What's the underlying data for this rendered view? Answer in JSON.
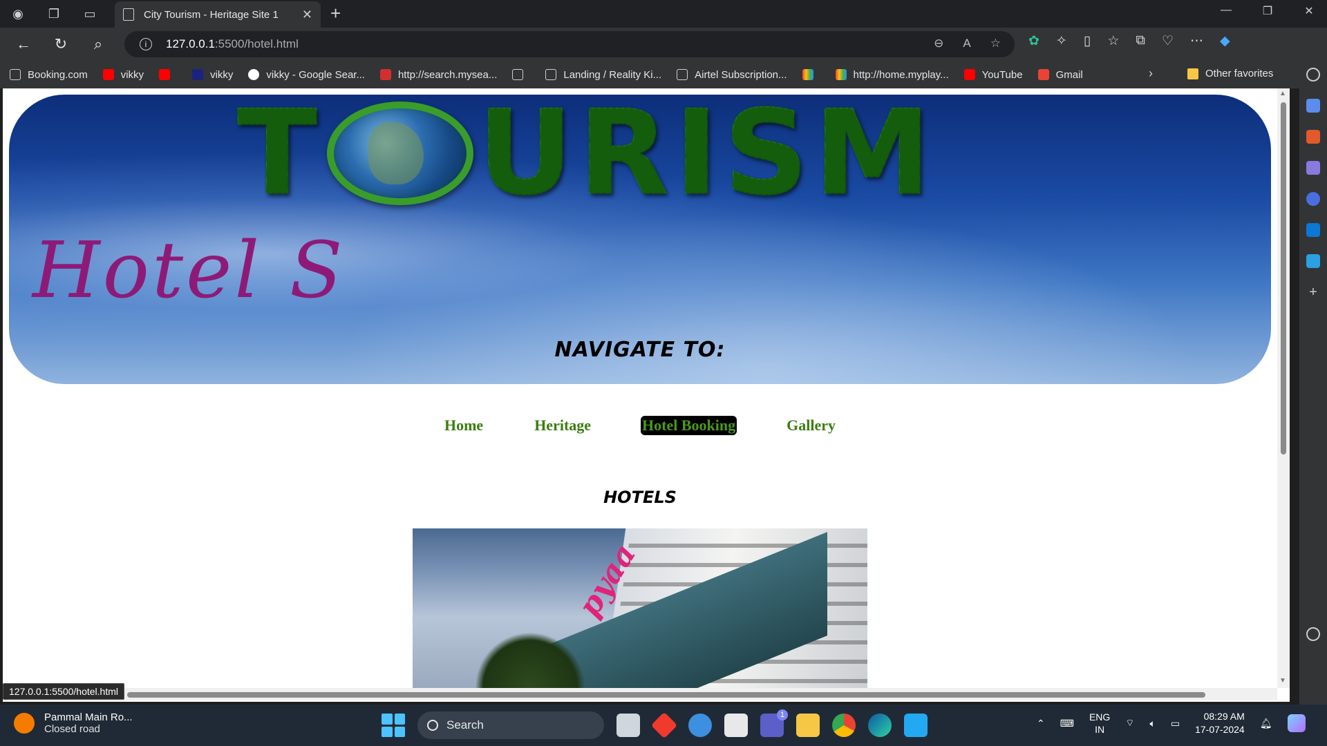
{
  "browser": {
    "tab_title": "City Tourism - Heritage Site 1",
    "url_host": "127.0.0.1",
    "url_path": ":5500/hotel.html",
    "status_url": "127.0.0.1:5500/hotel.html",
    "bookmarks": [
      {
        "label": "Booking.com",
        "icon": "page"
      },
      {
        "label": "vikky",
        "icon": "yt"
      },
      {
        "label": "",
        "icon": "yt"
      },
      {
        "label": "vikky",
        "icon": "eh"
      },
      {
        "label": "vikky - Google Sear...",
        "icon": "g"
      },
      {
        "label": "http://search.mysea...",
        "icon": "ask"
      },
      {
        "label": "",
        "icon": "page"
      },
      {
        "label": "Landing / Reality Ki...",
        "icon": "page"
      },
      {
        "label": "Airtel Subscription...",
        "icon": "page"
      },
      {
        "label": "",
        "icon": "bar"
      },
      {
        "label": "http://home.myplay...",
        "icon": "bar"
      },
      {
        "label": "YouTube",
        "icon": "yt"
      },
      {
        "label": "Gmail",
        "icon": "mail"
      }
    ],
    "other_favorites": "Other favorites"
  },
  "page": {
    "banner_title": "TOURISM",
    "banner_subtitle": "Hotel S",
    "navigate_label": "NAVIGATE TO:",
    "nav": [
      {
        "label": "Home",
        "active": false
      },
      {
        "label": "Heritage",
        "active": false
      },
      {
        "label": "Hotel Booking",
        "active": true
      },
      {
        "label": "Gallery",
        "active": false
      }
    ],
    "section_heading": "HOTELS",
    "hotel_sign": "pyaa"
  },
  "taskbar": {
    "weather_title": "Pammal Main Ro...",
    "weather_sub": "Closed road",
    "search_label": "Search",
    "lang_top": "ENG",
    "lang_bottom": "IN",
    "time": "08:29 AM",
    "date": "17-07-2024",
    "teams_badge": "1"
  },
  "colors": {
    "chrome_dark": "#202124",
    "chrome_mid": "#333436",
    "nav_green": "#3a7d12",
    "script_purple": "#8e1a78",
    "taskbar": "#202a36"
  }
}
